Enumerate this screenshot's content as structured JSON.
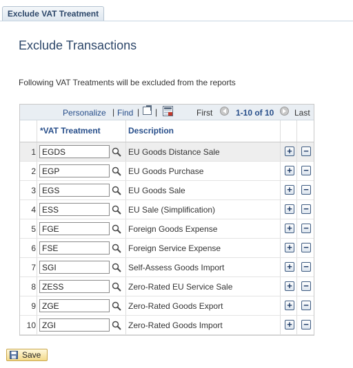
{
  "tab": {
    "label": "Exclude VAT Treatment"
  },
  "page": {
    "title": "Exclude Transactions",
    "instructions": "Following VAT Treatments will be excluded from the reports"
  },
  "grid": {
    "nav": {
      "personalize": "Personalize",
      "find": "Find",
      "first": "First",
      "range": "1-10 of 10",
      "last": "Last"
    },
    "columns": {
      "vat_treatment": "*VAT Treatment",
      "description": "Description"
    },
    "rows": [
      {
        "num": "1",
        "code": "EGDS",
        "description": "EU Goods Distance Sale"
      },
      {
        "num": "2",
        "code": "EGP",
        "description": "EU Goods Purchase"
      },
      {
        "num": "3",
        "code": "EGS",
        "description": "EU Goods Sale"
      },
      {
        "num": "4",
        "code": "ESS",
        "description": "EU Sale (Simplification)"
      },
      {
        "num": "5",
        "code": "FGE",
        "description": "Foreign Goods Expense"
      },
      {
        "num": "6",
        "code": "FSE",
        "description": "Foreign Service Expense"
      },
      {
        "num": "7",
        "code": "SGI",
        "description": "Self-Assess Goods Import"
      },
      {
        "num": "8",
        "code": "ZESS",
        "description": "Zero-Rated EU Service Sale"
      },
      {
        "num": "9",
        "code": "ZGE",
        "description": "Zero-Rated Goods Export"
      },
      {
        "num": "10",
        "code": "ZGI",
        "description": "Zero-Rated Goods Import"
      }
    ],
    "icons": {
      "add": "+",
      "delete": "−",
      "lookup": "lookup-icon"
    }
  },
  "toolbar": {
    "save_label": "Save"
  },
  "colors": {
    "heading": "#2c4669",
    "link": "#274e8a",
    "button_bg": "#f3d98a"
  }
}
